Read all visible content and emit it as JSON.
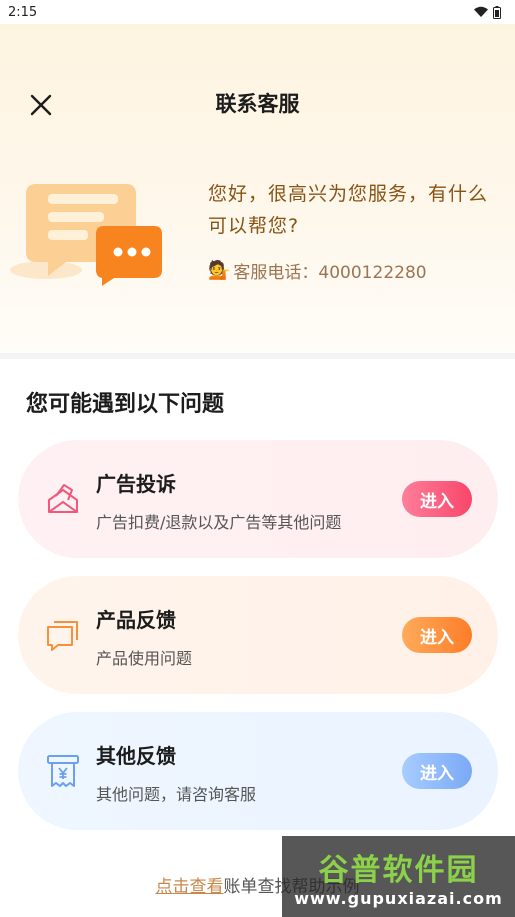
{
  "status_bar": {
    "time": "2:15"
  },
  "header": {
    "title": "联系客服",
    "greeting": "您好，很高兴为您服务，有什么可以帮您?",
    "phone_label": "客服电话：4000122280"
  },
  "section": {
    "title": "您可能遇到以下问题"
  },
  "cards": [
    {
      "title": "广告投诉",
      "subtitle": "广告扣费/退款以及广告等其他问题",
      "button": "进入"
    },
    {
      "title": "产品反馈",
      "subtitle": "产品使用问题",
      "button": "进入"
    },
    {
      "title": "其他反馈",
      "subtitle": "其他问题，请咨询客服",
      "button": "进入"
    }
  ],
  "footer": {
    "link": "点击查看",
    "text": "账单查找帮助示例"
  },
  "watermark": {
    "main": "谷普软件园",
    "sub": "www.gupuxiazai.com"
  },
  "colors": {
    "accent_pink": "#f8466a",
    "accent_orange": "#fd7d28",
    "accent_blue": "#7aa9f6",
    "greeting_brown": "#8a5316"
  },
  "icons": [
    "close-icon",
    "wifi-icon",
    "battery-icon",
    "chat-bubble-icon",
    "envelope-icon",
    "message-icon",
    "receipt-icon",
    "person-icon"
  ]
}
